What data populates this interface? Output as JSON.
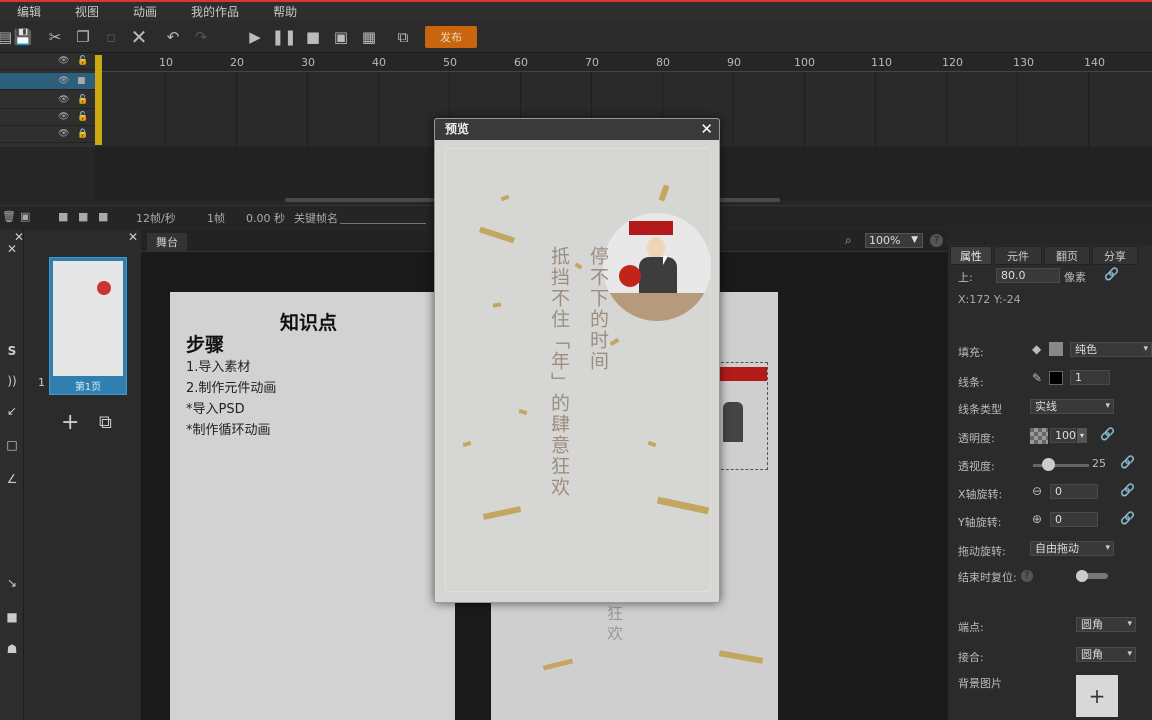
{
  "menu": [
    "编辑",
    "视图",
    "动画",
    "我的作品",
    "帮助"
  ],
  "toolbar": {
    "publish_label": "发布"
  },
  "ruler": [
    "10",
    "20",
    "30",
    "40",
    "50",
    "60",
    "70",
    "80",
    "90",
    "100",
    "110",
    "120",
    "130",
    "140"
  ],
  "timeline_status": {
    "fps": "12帧/秒",
    "frame": "1帧",
    "time": "0.00 秒",
    "keyframe_label": "关键帧名"
  },
  "pages": {
    "thumb_label": "第1页",
    "index": "1"
  },
  "stage": {
    "tab": "舞台",
    "zoom": "100%"
  },
  "canvas1": {
    "title": "知识点",
    "heading": "步骤",
    "lines": [
      "1.导入素材",
      "2.制作元件动画",
      "*导入PSD",
      "*制作循环动画"
    ]
  },
  "canvas2": {
    "chars": "狂\n欢"
  },
  "right_panel": {
    "tabs": [
      "属性",
      "元件",
      "翻页",
      "分享"
    ],
    "top_label": "上:",
    "top_value": "80.0",
    "top_unit": "像素",
    "coords": "X:172    Y:-24",
    "fill_label": "填充:",
    "fill_mode": "纯色",
    "stroke_label": "线条:",
    "stroke_value": "1",
    "stroke_type_label": "线条类型",
    "stroke_type": "实线",
    "opacity_label": "透明度:",
    "opacity_value": "100",
    "blur_label": "透视度:",
    "blur_value": "25",
    "xrot_label": "X轴旋转:",
    "xrot_value": "0",
    "yrot_label": "Y轴旋转:",
    "yrot_value": "0",
    "drag_label": "拖动旋转:",
    "drag_mode": "自由拖动",
    "reset_label": "结束时复位:",
    "cap_label": "端点:",
    "cap_value": "圆角",
    "join_label": "接合:",
    "join_value": "圆角",
    "bg_label": "背景图片"
  },
  "preview": {
    "title": "预览",
    "col_right": "停不下的时间",
    "col_left": "抵挡不住「年」的肆意狂欢"
  }
}
